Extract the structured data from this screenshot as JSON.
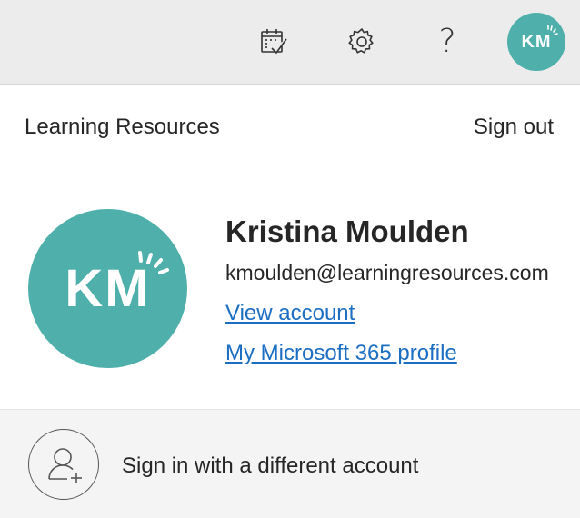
{
  "topbar": {
    "icons": [
      "calendar-check-icon",
      "gear-icon",
      "help-icon"
    ],
    "help_glyph": "?",
    "avatar_initials": "KM"
  },
  "panel": {
    "organization": "Learning Resources",
    "sign_out_label": "Sign out"
  },
  "profile": {
    "avatar_initials": "KM",
    "avatar_color": "#4fb0ab",
    "name": "Kristina Moulden",
    "email": "kmoulden@learningresources.com",
    "view_account_label": "View account",
    "profile_link_label": "My Microsoft 365 profile"
  },
  "footer": {
    "icon": "add-person-icon",
    "label": "Sign in with a different account"
  },
  "colors": {
    "accent_link": "#1b6ec2",
    "topbar_bg": "#ececec",
    "footer_bg": "#f4f4f4"
  }
}
